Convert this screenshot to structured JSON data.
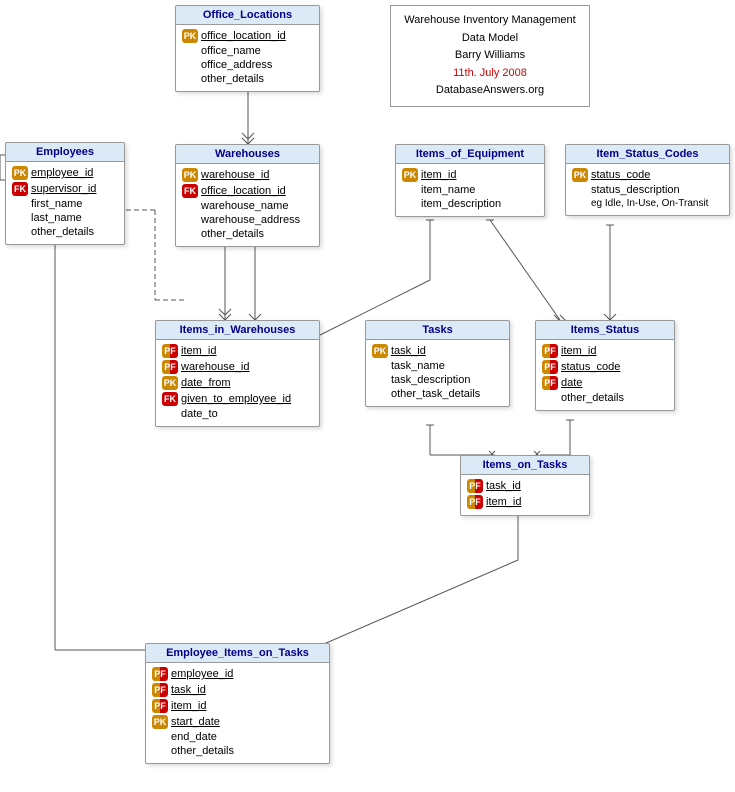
{
  "diagram": {
    "title": "Warehouse Inventory Management Data Model",
    "author": "Barry Williams",
    "date": "11th. July 2008",
    "website": "DatabaseAnswers.org"
  },
  "entities": {
    "office_locations": {
      "title": "Office_Locations",
      "fields": [
        {
          "name": "office_location_id",
          "badge": "pk",
          "underline": true
        },
        {
          "name": "office_name",
          "badge": null
        },
        {
          "name": "office_address",
          "badge": null
        },
        {
          "name": "other_details",
          "badge": null
        }
      ]
    },
    "employees": {
      "title": "Employees",
      "fields": [
        {
          "name": "employee_id",
          "badge": "pk",
          "underline": true
        },
        {
          "name": "supervisor_id",
          "badge": "fk",
          "underline": true
        },
        {
          "name": "first_name",
          "badge": null
        },
        {
          "name": "last_name",
          "badge": null
        },
        {
          "name": "other_details",
          "badge": null
        }
      ]
    },
    "warehouses": {
      "title": "Warehouses",
      "fields": [
        {
          "name": "warehouse_id",
          "badge": "pk",
          "underline": true
        },
        {
          "name": "office_location_id",
          "badge": "fk",
          "underline": true
        },
        {
          "name": "warehouse_name",
          "badge": null
        },
        {
          "name": "warehouse_address",
          "badge": null
        },
        {
          "name": "other_details",
          "badge": null
        }
      ]
    },
    "items_of_equipment": {
      "title": "Items_of_Equipment",
      "fields": [
        {
          "name": "item_id",
          "badge": "pk",
          "underline": true
        },
        {
          "name": "item_name",
          "badge": null
        },
        {
          "name": "item_description",
          "badge": null
        }
      ]
    },
    "item_status_codes": {
      "title": "Item_Status_Codes",
      "fields": [
        {
          "name": "status_code",
          "badge": "pk",
          "underline": true
        },
        {
          "name": "status_description",
          "badge": null
        },
        {
          "name": "eg Idle, In-Use, On-Transit",
          "badge": null
        }
      ]
    },
    "items_in_warehouses": {
      "title": "Items_in_Warehouses",
      "fields": [
        {
          "name": "item_id",
          "badge": "pf",
          "underline": true
        },
        {
          "name": "warehouse_id",
          "badge": "pf",
          "underline": true
        },
        {
          "name": "date_from",
          "badge": "pk",
          "underline": true
        },
        {
          "name": "given_to_employee_id",
          "badge": "fk",
          "underline": true
        },
        {
          "name": "date_to",
          "badge": null
        }
      ]
    },
    "tasks": {
      "title": "Tasks",
      "fields": [
        {
          "name": "task_id",
          "badge": "pk",
          "underline": true
        },
        {
          "name": "task_name",
          "badge": null
        },
        {
          "name": "task_description",
          "badge": null
        },
        {
          "name": "other_task_details",
          "badge": null
        }
      ]
    },
    "items_status": {
      "title": "Items_Status",
      "fields": [
        {
          "name": "item_id",
          "badge": "pf",
          "underline": true
        },
        {
          "name": "status_code",
          "badge": "pf",
          "underline": true
        },
        {
          "name": "date",
          "badge": "pf",
          "underline": true
        },
        {
          "name": "other_details",
          "badge": null
        }
      ]
    },
    "items_on_tasks": {
      "title": "Items_on_Tasks",
      "fields": [
        {
          "name": "task_id",
          "badge": "pf",
          "underline": true
        },
        {
          "name": "item_id",
          "badge": "pf",
          "underline": true
        }
      ]
    },
    "employee_items_on_tasks": {
      "title": "Employee_Items_on_Tasks",
      "fields": [
        {
          "name": "employee_id",
          "badge": "pf",
          "underline": true
        },
        {
          "name": "task_id",
          "badge": "pf",
          "underline": true
        },
        {
          "name": "item_id",
          "badge": "pf",
          "underline": true
        },
        {
          "name": "start_date",
          "badge": "pk",
          "underline": true
        },
        {
          "name": "end_date",
          "badge": null
        },
        {
          "name": "other_details",
          "badge": null
        }
      ]
    }
  },
  "badges": {
    "pk": "PK",
    "fk": "FK",
    "pf": "PF"
  }
}
